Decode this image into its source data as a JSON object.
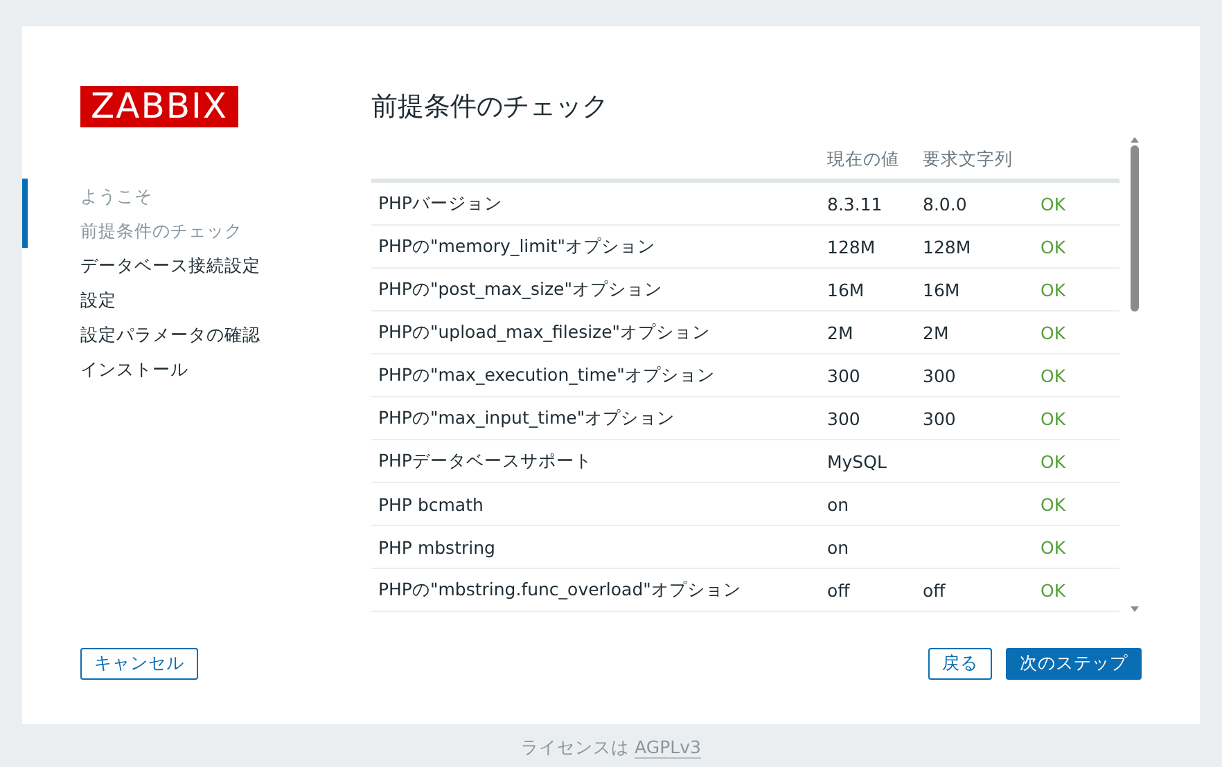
{
  "logo": {
    "text": "ZABBIX"
  },
  "steps": [
    {
      "label": "ようこそ",
      "done": true
    },
    {
      "label": "前提条件のチェック",
      "done": true
    },
    {
      "label": "データベース接続設定",
      "done": false
    },
    {
      "label": "設定",
      "done": false
    },
    {
      "label": "設定パラメータの確認",
      "done": false
    },
    {
      "label": "インストール",
      "done": false
    }
  ],
  "title": "前提条件のチェック",
  "table": {
    "columns": [
      "現在の値",
      "要求文字列"
    ],
    "rows": [
      {
        "name": "PHPバージョン",
        "current": "8.3.11",
        "required": "8.0.0",
        "status": "OK",
        "ok": true
      },
      {
        "name": "PHPの\"memory_limit\"オプション",
        "current": "128M",
        "required": "128M",
        "status": "OK",
        "ok": true
      },
      {
        "name": "PHPの\"post_max_size\"オプション",
        "current": "16M",
        "required": "16M",
        "status": "OK",
        "ok": true
      },
      {
        "name": "PHPの\"upload_max_filesize\"オプション",
        "current": "2M",
        "required": "2M",
        "status": "OK",
        "ok": true
      },
      {
        "name": "PHPの\"max_execution_time\"オプション",
        "current": "300",
        "required": "300",
        "status": "OK",
        "ok": true
      },
      {
        "name": "PHPの\"max_input_time\"オプション",
        "current": "300",
        "required": "300",
        "status": "OK",
        "ok": true
      },
      {
        "name": "PHPデータベースサポート",
        "current": "MySQL",
        "status": "OK",
        "ok": true
      },
      {
        "name": "PHP bcmath",
        "current": "on",
        "status": "OK",
        "ok": true
      },
      {
        "name": "PHP mbstring",
        "current": "on",
        "status": "OK",
        "ok": true
      },
      {
        "name": "PHPの\"mbstring.func_overload\"オプション",
        "current": "off",
        "required": "off",
        "status": "OK",
        "ok": true
      }
    ]
  },
  "buttons": {
    "cancel": "キャンセル",
    "back": "戻る",
    "next": "次のステップ"
  },
  "footer": {
    "text": "ライセンスは",
    "link": "AGPLv3"
  }
}
